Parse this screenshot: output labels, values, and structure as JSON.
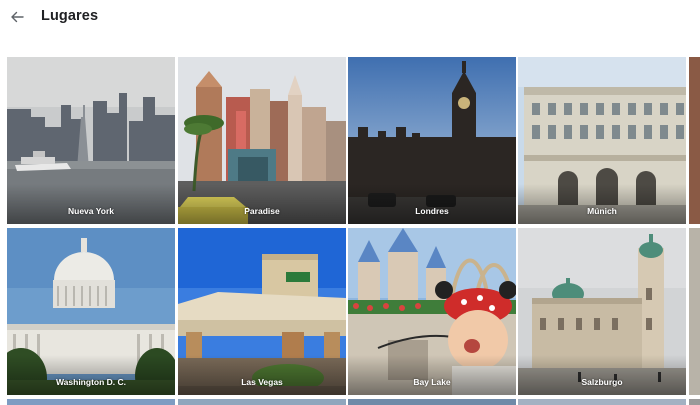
{
  "header": {
    "title": "Lugares",
    "back_icon": "arrow-back-icon"
  },
  "places": [
    {
      "label": "Nueva York"
    },
    {
      "label": "Paradise"
    },
    {
      "label": "Londres"
    },
    {
      "label": "Múnich"
    },
    {
      "label": "Washington D. C."
    },
    {
      "label": "Las Vegas"
    },
    {
      "label": "Bay Lake"
    },
    {
      "label": "Salzburgo"
    }
  ]
}
